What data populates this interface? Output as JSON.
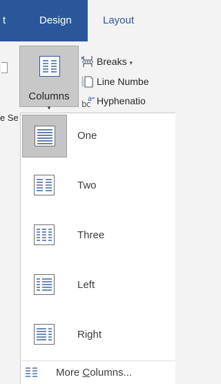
{
  "tabs": {
    "partial_left": "t",
    "design": "Design",
    "layout": "Layout"
  },
  "ribbon": {
    "partial_group_label": "e Se",
    "columns": {
      "label": "Columns",
      "caret": "▾",
      "icon": "columns-page-icon"
    },
    "breaks": {
      "label": "Breaks",
      "caret": "▾",
      "icon": "breaks-icon"
    },
    "line_numbers": {
      "label": "Line Numbe",
      "icon": "line-numbers-icon"
    },
    "hyphenation": {
      "label": "Hyphenatio",
      "icon": "hyphenation-icon"
    }
  },
  "columns_menu": {
    "selected": "One",
    "items": [
      {
        "label": "One",
        "icon": "one-column-icon"
      },
      {
        "label": "Two",
        "icon": "two-columns-icon"
      },
      {
        "label": "Three",
        "icon": "three-columns-icon"
      },
      {
        "label": "Left",
        "icon": "left-column-icon"
      },
      {
        "label": "Right",
        "icon": "right-column-icon"
      }
    ],
    "more": {
      "before": "More ",
      "underlined": "C",
      "after": "olumns...",
      "icon": "more-columns-icon"
    }
  },
  "colors": {
    "ribbon_tab_bar": "#2b579a",
    "active_tab_text": "#2b579a",
    "selected_item_bg": "#c5c5c5",
    "icon_accent": "#2b579a"
  }
}
